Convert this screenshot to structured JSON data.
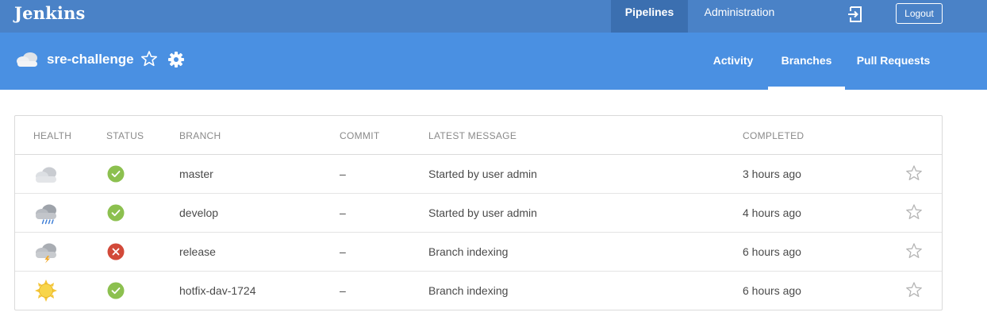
{
  "topbar": {
    "brand": "Jenkins",
    "nav": [
      {
        "label": "Pipelines",
        "active": true
      },
      {
        "label": "Administration",
        "active": false
      }
    ],
    "exit_icon": "sign-out-icon",
    "logout_label": "Logout"
  },
  "pipeline": {
    "name": "sre-challenge",
    "health_icon": "cloudy-icon",
    "tabs": [
      {
        "label": "Activity",
        "active": false
      },
      {
        "label": "Branches",
        "active": true
      },
      {
        "label": "Pull Requests",
        "active": false
      }
    ]
  },
  "table": {
    "headers": {
      "health": "HEALTH",
      "status": "STATUS",
      "branch": "BRANCH",
      "commit": "COMMIT",
      "message": "LATEST MESSAGE",
      "completed": "COMPLETED"
    },
    "rows": [
      {
        "health": "cloudy-icon",
        "status": "success",
        "branch": "master",
        "commit": "–",
        "message": "Started by user admin",
        "completed": "3 hours ago"
      },
      {
        "health": "raining-icon",
        "status": "success",
        "branch": "develop",
        "commit": "–",
        "message": "Started by user admin",
        "completed": "4 hours ago"
      },
      {
        "health": "storm-icon",
        "status": "failure",
        "branch": "release",
        "commit": "–",
        "message": "Branch indexing",
        "completed": "6 hours ago"
      },
      {
        "health": "sunny-icon",
        "status": "success",
        "branch": "hotfix-dav-1724",
        "commit": "–",
        "message": "Branch indexing",
        "completed": "6 hours ago"
      }
    ]
  },
  "colors": {
    "topbar": "#4a82c7",
    "subbar": "#4a90e2",
    "success": "#8cc04f",
    "failure": "#d24939"
  }
}
